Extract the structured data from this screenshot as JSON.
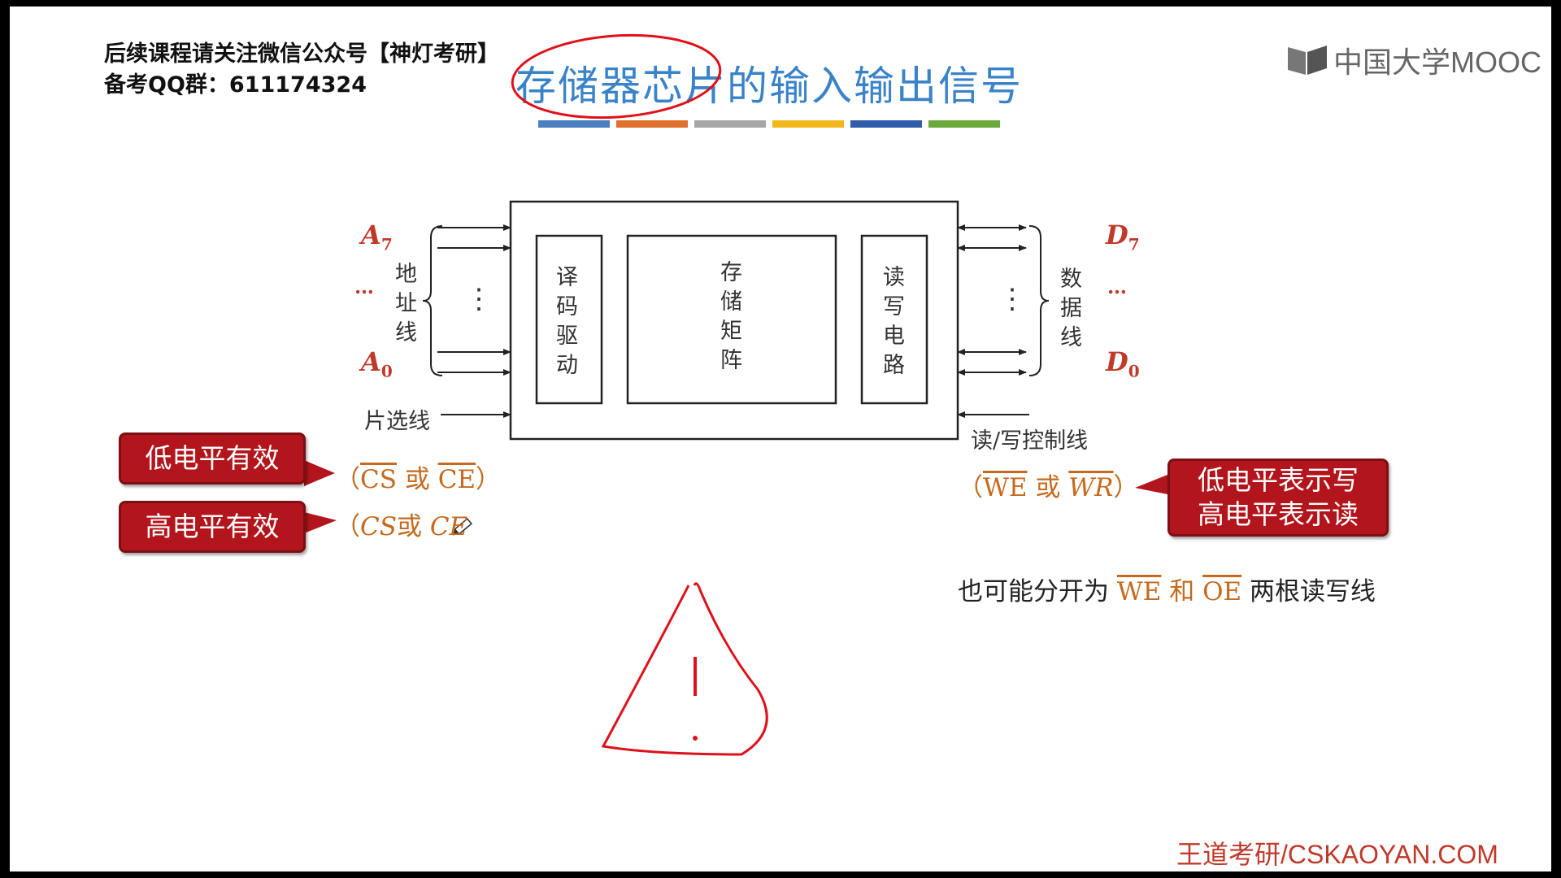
{
  "header": {
    "note_line1": "后续课程请关注微信公众号【神灯考研】",
    "note_line2": "备考QQ群：611174324",
    "title": "存储器芯片的输入输出信号",
    "logo": "中国大学MOOC",
    "color_bar": [
      "#4a7fc1",
      "#e0702e",
      "#a6a6a6",
      "#f0b81a",
      "#2f5ca8",
      "#6aaa3a"
    ]
  },
  "diagram": {
    "decoder": "译码驱动",
    "matrix": "存储矩阵",
    "rw_circuit": "读写电路",
    "address_lines": "地址线",
    "data_lines": "数据线",
    "chip_select": "片选线",
    "rw_control": "读/写控制线",
    "a7": "A",
    "a7_sub": "7",
    "a0": "A",
    "a0_sub": "0",
    "d7": "D",
    "d7_sub": "7",
    "d0": "D",
    "d0_sub": "0",
    "ellipsis": "…",
    "vdots": "⋮"
  },
  "annotations": {
    "low_active": "低电平有效",
    "high_active": "高电平有效",
    "cs": "CS",
    "ce": "CE",
    "or": "或",
    "lp": "（",
    "rp": "）",
    "we": "WE",
    "wr": "WR",
    "oe": "OE",
    "low_write": "低电平表示写",
    "high_read": "高电平表示读",
    "split_pre": "也可能分开为",
    "split_and": "和",
    "split_post": "两根读写线"
  },
  "footer": {
    "brand": "王道考研/CSKAOYAN.COM"
  },
  "colors": {
    "title": "#3a83c9",
    "callout": "#b2151b",
    "signal": "#c56a1e",
    "pen": "#e0101a"
  }
}
